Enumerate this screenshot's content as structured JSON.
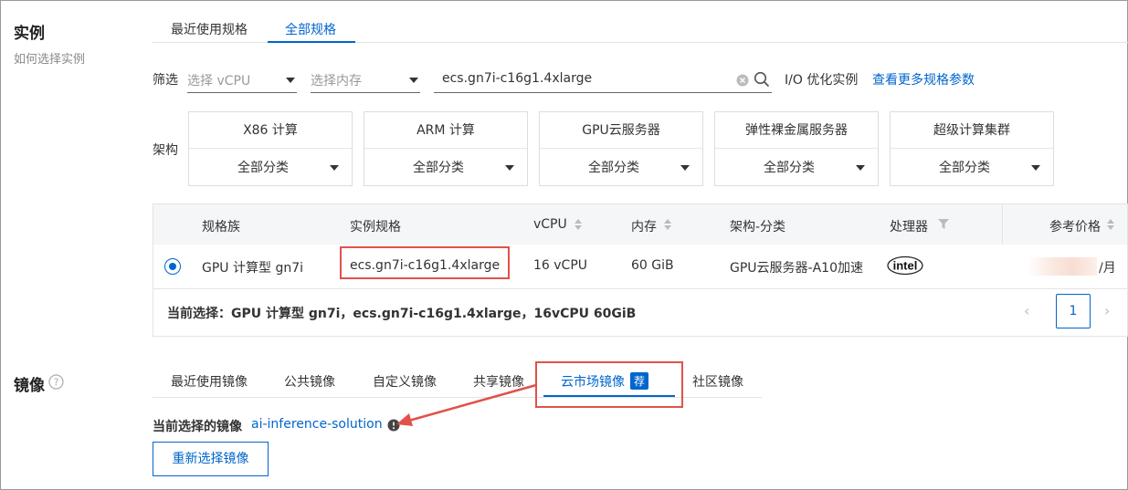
{
  "instance": {
    "title": "实例",
    "help_link": "如何选择实例",
    "tabs": [
      "最近使用规格",
      "全部规格"
    ],
    "active_tab": "全部规格",
    "filter": {
      "label": "筛选",
      "vcpu_placeholder": "选择 vCPU",
      "memory_placeholder": "选择内存",
      "search_value": "ecs.gn7i-c16g1.4xlarge",
      "io_optimized": "I/O 优化实例",
      "more_params_link": "查看更多规格参数"
    },
    "arch": {
      "label": "架构",
      "options": [
        {
          "name": "X86 计算",
          "category": "全部分类"
        },
        {
          "name": "ARM 计算",
          "category": "全部分类"
        },
        {
          "name": "GPU云服务器",
          "category": "全部分类"
        },
        {
          "name": "弹性裸金属服务器",
          "category": "全部分类"
        },
        {
          "name": "超级计算集群",
          "category": "全部分类"
        }
      ]
    },
    "table": {
      "headers": [
        "规格族",
        "实例规格",
        "vCPU",
        "内存",
        "架构-分类",
        "处理器",
        "参考价格"
      ],
      "row": {
        "family": "GPU 计算型 gn7i",
        "spec": "ecs.gn7i-c16g1.4xlarge",
        "vcpu": "16 vCPU",
        "memory": "60 GiB",
        "arch": "GPU云服务器-A10加速",
        "processor_logo": "intel",
        "price_suffix": "/月"
      },
      "current_selection": "当前选择：GPU 计算型 gn7i，ecs.gn7i-c16g1.4xlarge，16vCPU 60GiB",
      "page": "1"
    }
  },
  "image": {
    "title": "镜像",
    "tabs": [
      "最近使用镜像",
      "公共镜像",
      "自定义镜像",
      "共享镜像",
      "云市场镜像",
      "社区镜像"
    ],
    "active_tab": "云市场镜像",
    "marketplace_badge": "荐",
    "current_label": "当前选择的镜像",
    "current_value": "ai-inference-solution",
    "reselect_button": "重新选择镜像"
  },
  "colors": {
    "accent": "#0066cc",
    "highlight": "#e0524a"
  }
}
